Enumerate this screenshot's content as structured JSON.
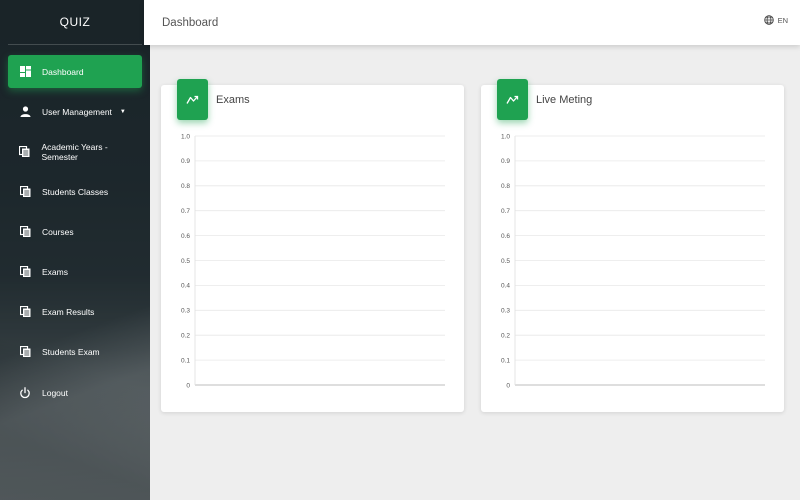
{
  "app": {
    "brand": "QUIZ"
  },
  "sidebar": {
    "items": [
      {
        "label": "Dashboard",
        "icon": "dashboard-icon"
      },
      {
        "label": "User Management",
        "icon": "person-icon"
      },
      {
        "label": "Academic Years - Semester",
        "icon": "copy-icon"
      },
      {
        "label": "Students Classes",
        "icon": "copy-icon"
      },
      {
        "label": "Courses",
        "icon": "copy-icon"
      },
      {
        "label": "Exams",
        "icon": "copy-icon"
      },
      {
        "label": "Exam Results",
        "icon": "copy-icon"
      },
      {
        "label": "Students Exam",
        "icon": "copy-icon"
      },
      {
        "label": "Logout",
        "icon": "power-icon"
      }
    ],
    "active_index": 0
  },
  "header": {
    "title": "Dashboard",
    "language": "EN",
    "language_icon": "globe-icon"
  },
  "colors": {
    "accent": "#1fa251",
    "sidebar_dark": "#1f2a30",
    "background": "#eeeeee"
  },
  "chart_data": [
    {
      "type": "line",
      "title": "Exams",
      "icon": "trending-icon",
      "y_ticks": [
        "1.0",
        "0.9",
        "0.8",
        "0.7",
        "0.6",
        "0.5",
        "0.4",
        "0.3",
        "0.2",
        "0.1",
        "0"
      ],
      "ylim": [
        0,
        1
      ],
      "series": [],
      "grid": true
    },
    {
      "type": "line",
      "title": "Live Meting",
      "icon": "trending-icon",
      "y_ticks": [
        "1.0",
        "0.9",
        "0.8",
        "0.7",
        "0.6",
        "0.5",
        "0.4",
        "0.3",
        "0.2",
        "0.1",
        "0"
      ],
      "ylim": [
        0,
        1
      ],
      "series": [],
      "grid": true
    }
  ]
}
